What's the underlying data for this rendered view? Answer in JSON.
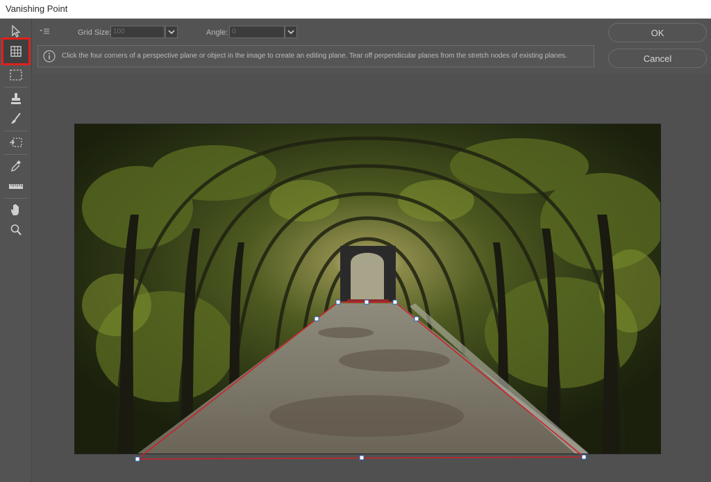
{
  "window": {
    "title": "Vanishing Point"
  },
  "tools": [
    {
      "name": "edit-plane-tool",
      "icon": "arrow-cursor-icon"
    },
    {
      "name": "create-plane-tool",
      "icon": "grid-plane-icon",
      "active": true
    },
    {
      "name": "marquee-tool",
      "icon": "dashed-rectangle-icon"
    },
    {
      "name": "stamp-tool",
      "icon": "stamp-icon"
    },
    {
      "name": "brush-tool",
      "icon": "brush-icon"
    },
    {
      "name": "transform-tool",
      "icon": "transform-icon"
    },
    {
      "name": "eyedropper-tool",
      "icon": "eyedropper-icon"
    },
    {
      "name": "measure-tool",
      "icon": "ruler-icon"
    },
    {
      "name": "hand-tool",
      "icon": "hand-icon"
    },
    {
      "name": "zoom-tool",
      "icon": "zoom-icon"
    }
  ],
  "options": {
    "grid_size_label": "Grid Size:",
    "grid_size_value": "100",
    "angle_label": "Angle:",
    "angle_value": "0"
  },
  "info": {
    "text": "Click the four corners of a perspective plane or object in the image to create an editing plane. Tear off perpendicular planes from the stretch nodes of existing planes."
  },
  "buttons": {
    "ok": "OK",
    "cancel": "Cancel"
  },
  "colors": {
    "panel": "#535353",
    "plane_edge": "#c8222a",
    "node_fill": "#ffffff",
    "node_stroke": "#2a5fb0",
    "active_tool_highlight": "#e0201b"
  }
}
